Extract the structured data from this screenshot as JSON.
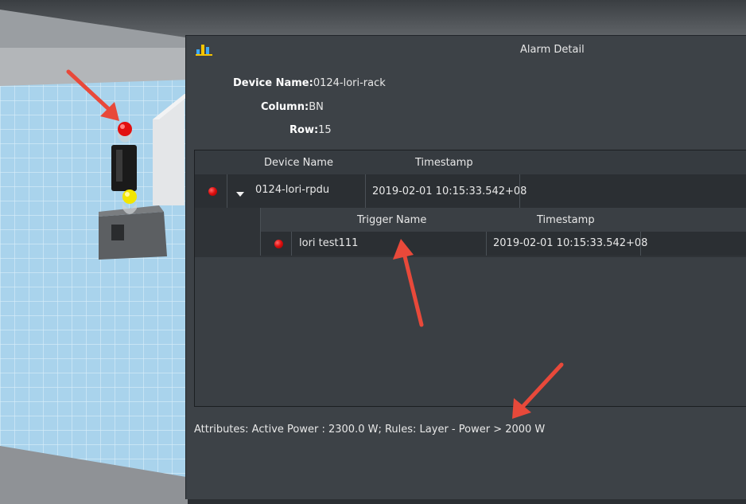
{
  "window": {
    "title": "Alarm Detail",
    "icon": "bar-chart-icon"
  },
  "device_info": {
    "device_name_label": "Device Name:",
    "device_name_value": "0124-lori-rack",
    "column_label": "Column:",
    "column_value": "BN",
    "row_label": "Row:",
    "row_value": "15"
  },
  "alarm_grid": {
    "columns": [
      "Device Name",
      "Timestamp"
    ],
    "rows": [
      {
        "status_color": "#e01010",
        "device_name": "0124-lori-rpdu",
        "timestamp": "2019-02-01 10:15:33.542+08",
        "expanded": true,
        "triggers": {
          "columns": [
            "Trigger Name",
            "Timestamp"
          ],
          "rows": [
            {
              "status_color": "#e01010",
              "trigger_name": "lori test111",
              "timestamp": "2019-02-01 10:15:33.542+08"
            }
          ]
        }
      }
    ]
  },
  "footer": {
    "attributes_text": "Attributes: Active Power : 2300.0 W; Rules: Layer - Power > 2000 W"
  },
  "colors": {
    "panel_bg": "#3d4247",
    "floor_blue": "#a7d2ec",
    "annotation_arrow": "#e8493a",
    "alarm_red": "#e01010",
    "alarm_yellow": "#f2e600"
  }
}
